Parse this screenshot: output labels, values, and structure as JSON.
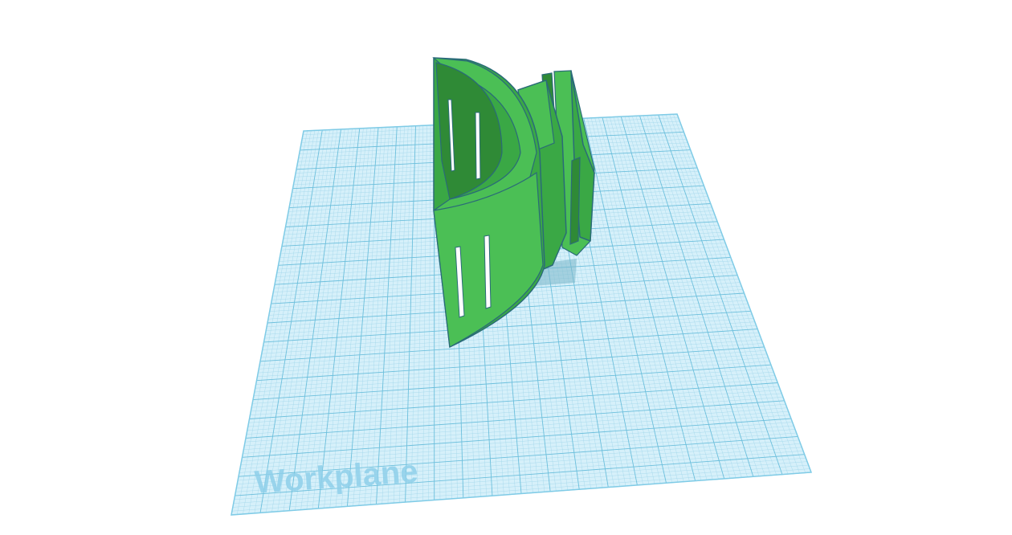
{
  "workplane": {
    "label": "Workplane",
    "grid_major_divisions": 20,
    "grid_minor_per_major": 5
  },
  "model": {
    "name": "green-bracket",
    "body_color": "#3aa845",
    "edge_color": "#2a6b78",
    "dark_face_color": "#2f8a36",
    "light_face_color": "#4bbf55"
  },
  "colors": {
    "canvas_background": "#ffffff",
    "workplane_fill": "#d6f0fa",
    "grid_minor": "#9fd6ea",
    "grid_major": "#6cbfdc",
    "workplane_border": "#7fcbe6",
    "label_color": "#8fd0ea"
  }
}
